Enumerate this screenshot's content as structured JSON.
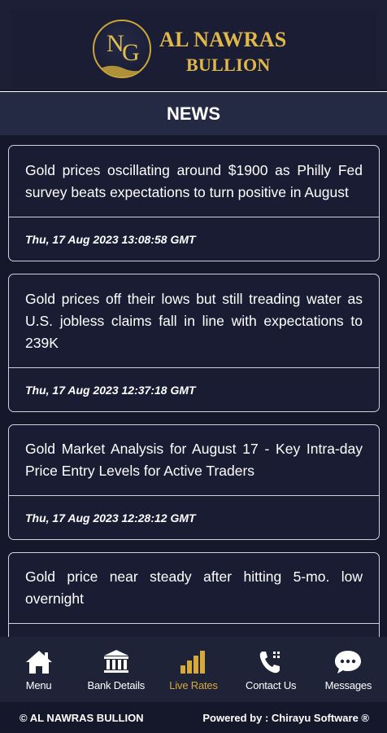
{
  "brand": {
    "logo_monogram_n": "N",
    "logo_monogram_g": "G",
    "name_line1": "AL NAWRAS",
    "name_line2": "BULLION",
    "gold_color": "#e0b84a"
  },
  "page": {
    "title": "NEWS"
  },
  "news": [
    {
      "headline": "Gold prices oscillating around $1900 as Philly Fed survey beats expectations to turn positive in August",
      "timestamp": "Thu, 17 Aug 2023 13:08:58 GMT"
    },
    {
      "headline": "Gold prices off their lows but still treading water as U.S. jobless claims fall in line with expectations to 239K",
      "timestamp": "Thu, 17 Aug 2023 12:37:18 GMT"
    },
    {
      "headline": "Gold Market Analysis for August 17 - Key Intra-day Price Entry Levels for Active Traders",
      "timestamp": "Thu, 17 Aug 2023 12:28:12 GMT"
    },
    {
      "headline": "Gold price near steady after hitting 5-mo. low overnight",
      "timestamp": ""
    }
  ],
  "nav": [
    {
      "label": "Menu",
      "icon": "home-icon"
    },
    {
      "label": "Bank Details",
      "icon": "bank-icon"
    },
    {
      "label": "Live Rates",
      "icon": "bar-chart-icon",
      "active": true
    },
    {
      "label": "Contact Us",
      "icon": "phone-icon"
    },
    {
      "label": "Messages",
      "icon": "chat-bubble-icon"
    }
  ],
  "footer": {
    "copyright": "© AL NAWRAS BULLION",
    "powered_by": "Powered by : Chirayu Software ®"
  },
  "colors": {
    "background": "#15172b",
    "accent_gold": "#d7a83a",
    "card_border": "#cfd2dc"
  }
}
